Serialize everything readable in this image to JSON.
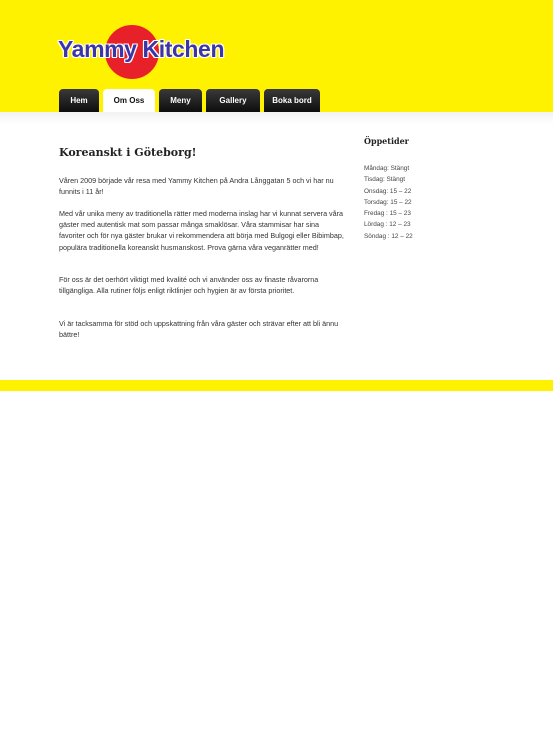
{
  "brand": {
    "name": "Yammy Kitchen"
  },
  "nav": {
    "items": [
      {
        "label": "Hem",
        "active": false
      },
      {
        "label": "Om Oss",
        "active": true
      },
      {
        "label": "Meny",
        "active": false
      },
      {
        "label": "Gallery",
        "active": false
      },
      {
        "label": "Boka bord",
        "active": false
      }
    ]
  },
  "main": {
    "title": "Koreanskt i Göteborg!",
    "paragraphs": [
      "Våren 2009 började vår resa med Yammy Kitchen på Andra Långgatan 5 och vi har nu funnits i 11 år!",
      "Med vår unika meny av traditionella rätter med moderna inslag har vi kunnat servera våra gäster med autentisk mat som passar många smaklösar. Våra stammisar har sina favoriter och för nya gäster brukar vi rekommendera att börja med Bulgogi eller Bibimbap, populära traditionella koreanskt husmanskost. Prova gärna våra veganrätter med!",
      "För oss är det oerhört viktigt med kvalité och vi använder oss av finaste råvarorna tillgängliga. Alla rutiner följs enligt riktlinjer och hygien är av första prioritet.",
      "Vi är tacksamma för stöd och uppskattning från våra gäster och strävar efter att bli ännu bättre!"
    ]
  },
  "sidebar": {
    "title": "Öppetider",
    "hours": [
      "Måndag: Stängt",
      "Tisdag: Stängt",
      "Onsdag: 15 – 22",
      "Torsdag: 15 – 22",
      "Fredag : 15 – 23",
      "Lördag : 12 – 23",
      "Söndag : 12 – 22"
    ]
  },
  "colors": {
    "brand_yellow": "#fff200",
    "logo_red": "#e8202a",
    "logo_text": "#3b35a6",
    "nav_dark": "#111111"
  }
}
